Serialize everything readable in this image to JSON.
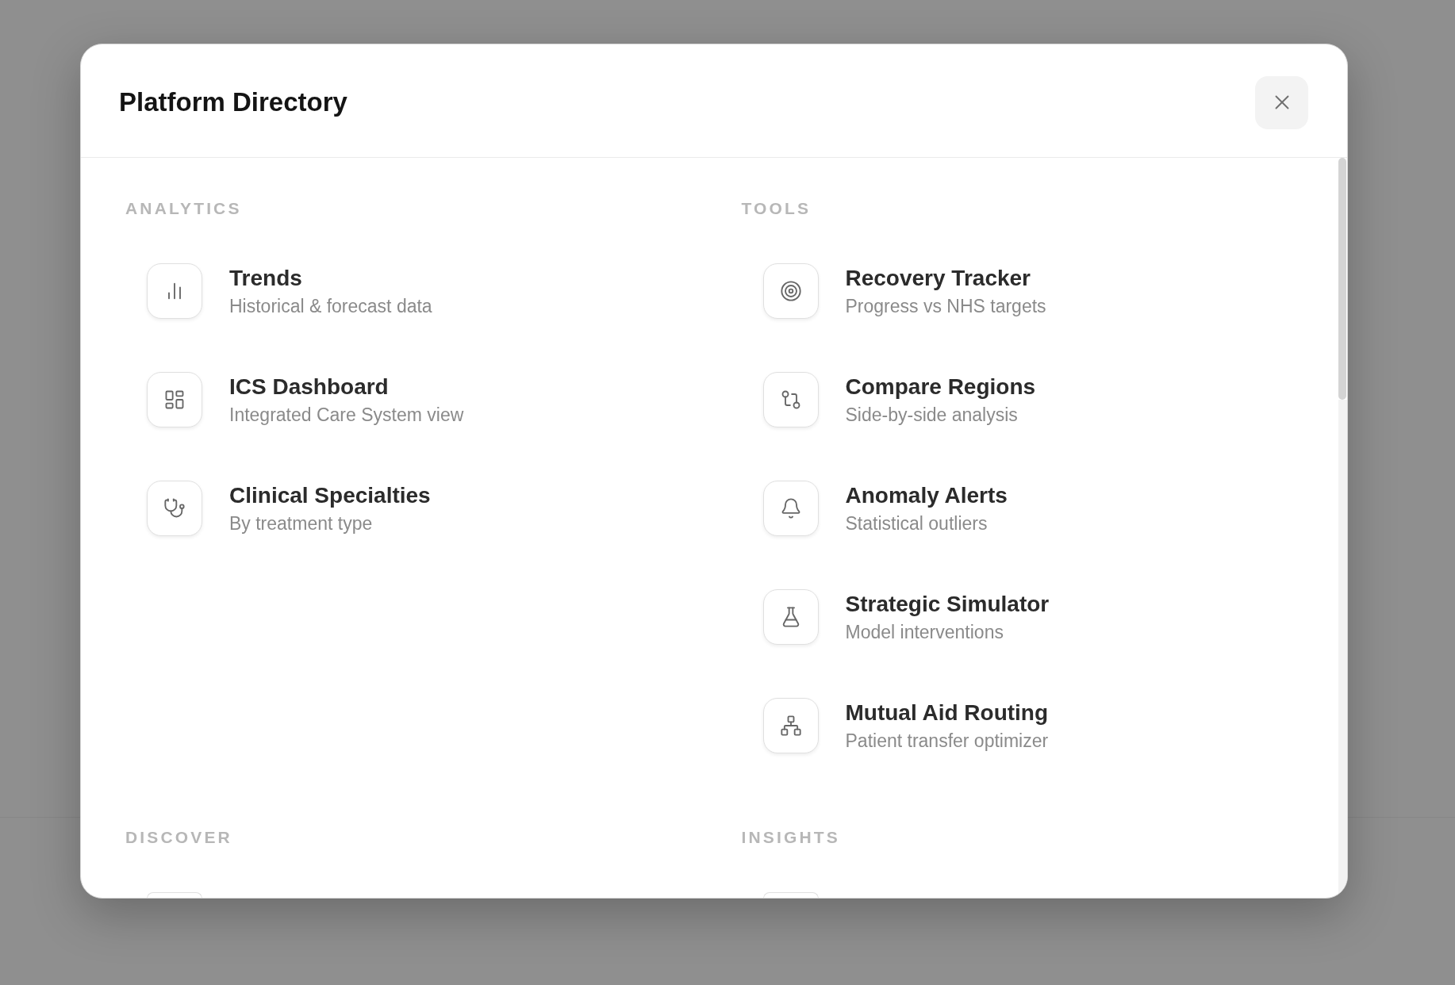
{
  "dialog": {
    "title": "Platform Directory",
    "sections": [
      {
        "label": "ANALYTICS",
        "items": [
          {
            "kind": "link",
            "title": "Trends",
            "subtitle": "Historical & forecast data"
          },
          {
            "kind": "link",
            "title": "ICS Dashboard",
            "subtitle": "Integrated Care System view"
          },
          {
            "kind": "link",
            "title": "Clinical Specialties",
            "subtitle": "By treatment type"
          }
        ]
      },
      {
        "label": "TOOLS",
        "items": [
          {
            "kind": "link",
            "title": "Recovery Tracker",
            "subtitle": "Progress vs NHS targets"
          },
          {
            "kind": "link",
            "title": "Compare Regions",
            "subtitle": "Side-by-side analysis"
          },
          {
            "kind": "link",
            "title": "Anomaly Alerts",
            "subtitle": "Statistical outliers"
          },
          {
            "kind": "link",
            "title": "Strategic Simulator",
            "subtitle": "Model interventions"
          },
          {
            "kind": "link",
            "title": "Mutual Aid Routing",
            "subtitle": "Patient transfer optimizer"
          }
        ]
      },
      {
        "label": "DISCOVER",
        "items": [
          {
            "kind": "clipped"
          }
        ]
      },
      {
        "label": "INSIGHTS",
        "items": [
          {
            "kind": "clipped"
          }
        ]
      }
    ]
  }
}
